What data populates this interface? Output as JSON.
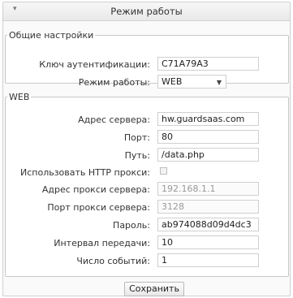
{
  "header": {
    "title": "Режим работы",
    "collapse_icon": "triangle-icon"
  },
  "general": {
    "legend": "Общие настройки",
    "auth_key_label": "Ключ аутентификации:",
    "auth_key_value": "C71A79A3",
    "mode_label": "Режим работы:",
    "mode_value": "WEB"
  },
  "web": {
    "legend": "WEB",
    "server_label": "Адрес сервера:",
    "server_value": "hw.guardsaas.com",
    "port_label": "Порт:",
    "port_value": "80",
    "path_label": "Путь:",
    "path_value": "/data.php",
    "use_proxy_label": "Использовать HTTP прокси:",
    "proxy_addr_label": "Адрес прокси сервера:",
    "proxy_addr_value": "192.168.1.1",
    "proxy_port_label": "Порт прокси сервера:",
    "proxy_port_value": "3128",
    "password_label": "Пароль:",
    "password_value": "ab974088d09d4dc3",
    "interval_label": "Интервал передачи:",
    "interval_value": "10",
    "events_label": "Число событий:",
    "events_value": "1"
  },
  "save_label": "Сохранить"
}
